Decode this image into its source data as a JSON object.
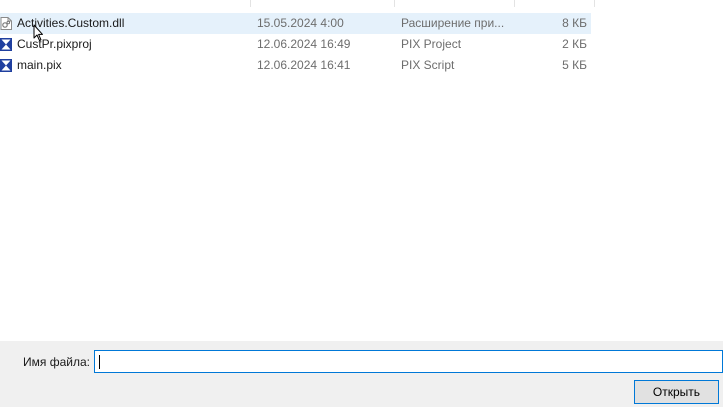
{
  "files": [
    {
      "name": "Activities.Custom.dll",
      "date": "15.05.2024 4:00",
      "type": "Расширение при...",
      "size": "8 КБ",
      "icon": "dll-file-icon",
      "selected": true
    },
    {
      "name": "CustPr.pixproj",
      "date": "12.06.2024 16:49",
      "type": "PIX Project",
      "size": "2 КБ",
      "icon": "pix-file-icon",
      "selected": false
    },
    {
      "name": "main.pix",
      "date": "12.06.2024 16:41",
      "type": "PIX Script",
      "size": "5 КБ",
      "icon": "pix-file-icon",
      "selected": false
    }
  ],
  "filename_label": "Имя файла:",
  "filename_value": "",
  "open_button": "Открыть",
  "colors": {
    "selection": "#e5f1fb",
    "accent": "#0078d7",
    "pix_icon": "#1f3f9f",
    "panel": "#f0f0f0"
  }
}
